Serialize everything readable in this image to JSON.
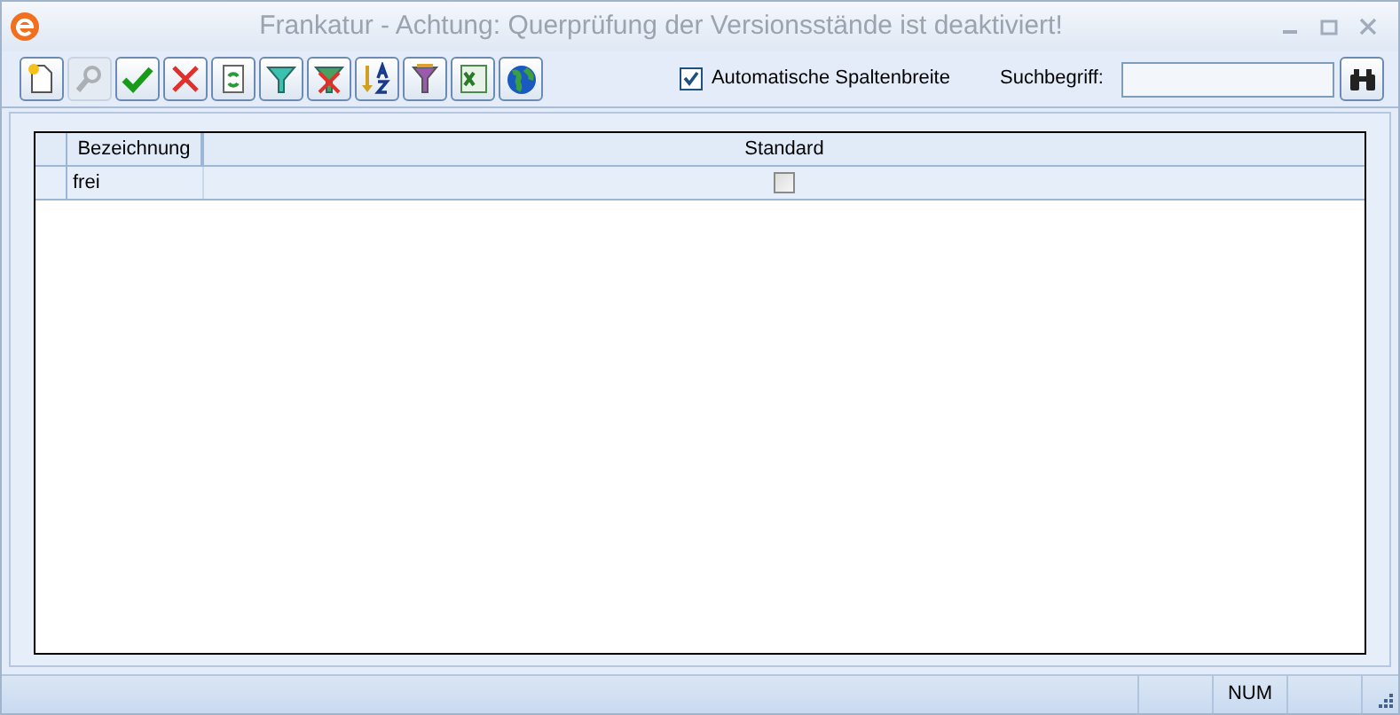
{
  "window": {
    "title": "Frankatur - Achtung: Querprüfung der Versionsstände ist deaktiviert!"
  },
  "toolbar": {
    "buttons": [
      {
        "kind": "new",
        "disabled": false
      },
      {
        "kind": "search",
        "disabled": true
      },
      {
        "kind": "accept",
        "disabled": false
      },
      {
        "kind": "delete",
        "disabled": false
      },
      {
        "kind": "refresh",
        "disabled": false
      },
      {
        "kind": "filter",
        "disabled": false
      },
      {
        "kind": "filter-clear",
        "disabled": false
      },
      {
        "kind": "sort",
        "disabled": false
      },
      {
        "kind": "filter-multi",
        "disabled": false
      },
      {
        "kind": "excel",
        "disabled": false
      },
      {
        "kind": "globe",
        "disabled": false
      }
    ]
  },
  "auto_column_width": {
    "label": "Automatische Spaltenbreite",
    "checked": true
  },
  "search": {
    "label": "Suchbegriff:"
  },
  "table": {
    "columns": [
      "Bezeichnung",
      "Standard"
    ],
    "rows": [
      {
        "bezeichnung": "frei",
        "standard": false
      }
    ]
  },
  "status_bar": {
    "num": "NUM"
  }
}
